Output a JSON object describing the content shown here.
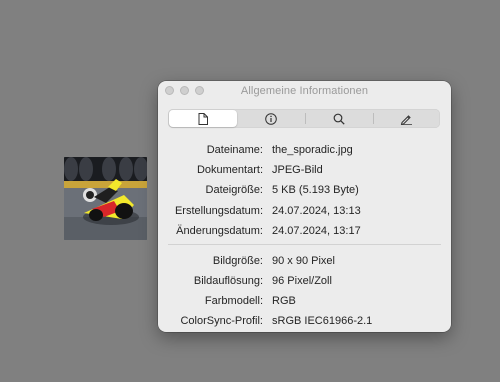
{
  "window": {
    "title": "Allgemeine Informationen"
  },
  "tabs": [
    {
      "icon": "document-icon",
      "active": true
    },
    {
      "icon": "info-icon",
      "active": false
    },
    {
      "icon": "magnifier-icon",
      "active": false
    },
    {
      "icon": "pencil-icon",
      "active": false
    }
  ],
  "file_info": [
    {
      "label": "Dateiname:",
      "value": "the_sporadic.jpg"
    },
    {
      "label": "Dokumentart:",
      "value": "JPEG-Bild"
    },
    {
      "label": "Dateigröße:",
      "value": "5 KB (5.193 Byte)"
    },
    {
      "label": "Erstellungsdatum:",
      "value": "24.07.2024, 13:13"
    },
    {
      "label": "Änderungsdatum:",
      "value": "24.07.2024, 13:17"
    }
  ],
  "image_info": [
    {
      "label": "Bildgröße:",
      "value": "90 x 90 Pixel"
    },
    {
      "label": "Bildauflösung:",
      "value": "96 Pixel/Zoll"
    },
    {
      "label": "Farbmodell:",
      "value": "RGB"
    },
    {
      "label": "ColorSync-Profil:",
      "value": "sRGB IEC61966-2.1"
    }
  ]
}
